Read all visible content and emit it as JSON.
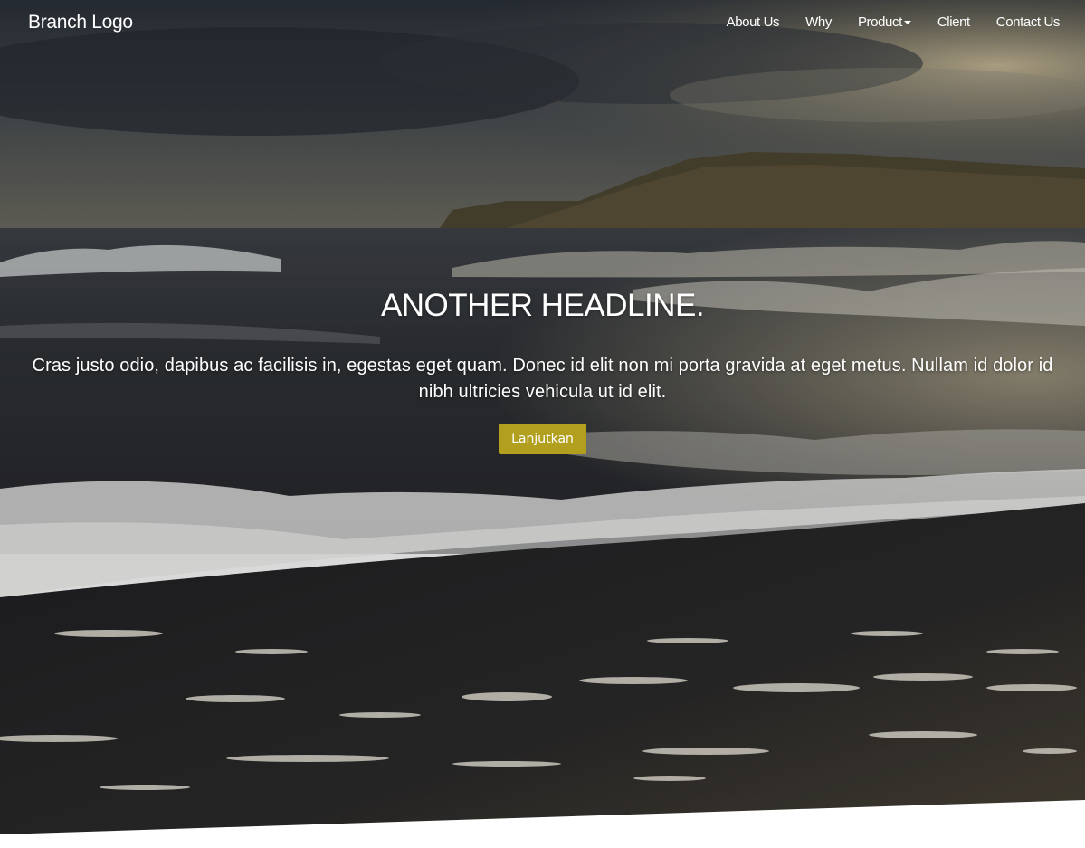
{
  "navbar": {
    "brand": "Branch Logo",
    "items": [
      {
        "label": "About Us",
        "has_dropdown": false
      },
      {
        "label": "Why",
        "has_dropdown": false
      },
      {
        "label": "Product",
        "has_dropdown": true
      },
      {
        "label": "Client",
        "has_dropdown": false
      },
      {
        "label": "Contact Us",
        "has_dropdown": false
      }
    ]
  },
  "hero": {
    "headline": "ANOTHER HEADLINE.",
    "lead": "Cras justo odio, dapibus ac facilisis in, egestas eget quam. Donec id elit non mi porta gravida at eget metus. Nullam id dolor id nibh ultricies vehicula ut id elit.",
    "button_label": "Lanjutkan",
    "background_image": "stormy-beach-waves-photo"
  },
  "colors": {
    "accent": "#b39f1e",
    "text": "#ffffff",
    "page_background": "#ffffff"
  }
}
